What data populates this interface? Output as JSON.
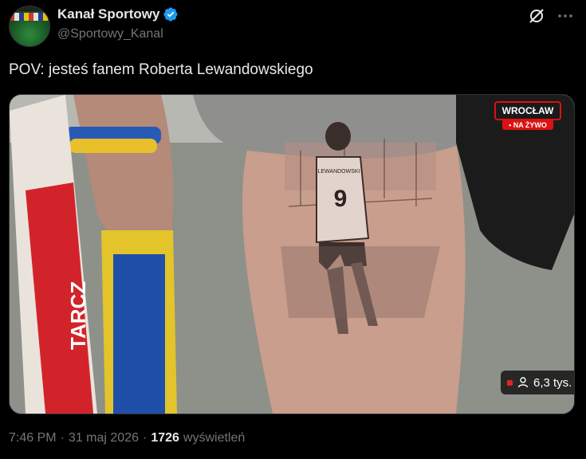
{
  "author": {
    "display_name": "Kanał Sportowy",
    "handle": "@Sportowy_Kanal"
  },
  "tweet": {
    "text": "POV: jesteś fanem Roberta Lewandowskiego"
  },
  "media": {
    "live_badge_city": "WROCŁAW",
    "live_badge_status": "• NA ŻYWO",
    "viewers": "6,3 tys.",
    "tattoo_jersey_name": "LEWANDOWSKI",
    "tattoo_jersey_number": "9",
    "scarf_text": "TARCZ"
  },
  "meta": {
    "time": "7:46 PM",
    "separator1": "·",
    "date": "31 maj 2026",
    "separator2": "·",
    "views_count": "1726",
    "views_label": "wyświetleń"
  },
  "icons": {
    "verified": "verified-badge-icon",
    "grok": "grok-icon",
    "more": "more-icon",
    "viewer": "person-icon"
  },
  "colors": {
    "background": "#000000",
    "text_primary": "#e7e9ea",
    "text_secondary": "#71767b",
    "verified_blue": "#1d9bf0",
    "live_red": "#dd1111"
  }
}
